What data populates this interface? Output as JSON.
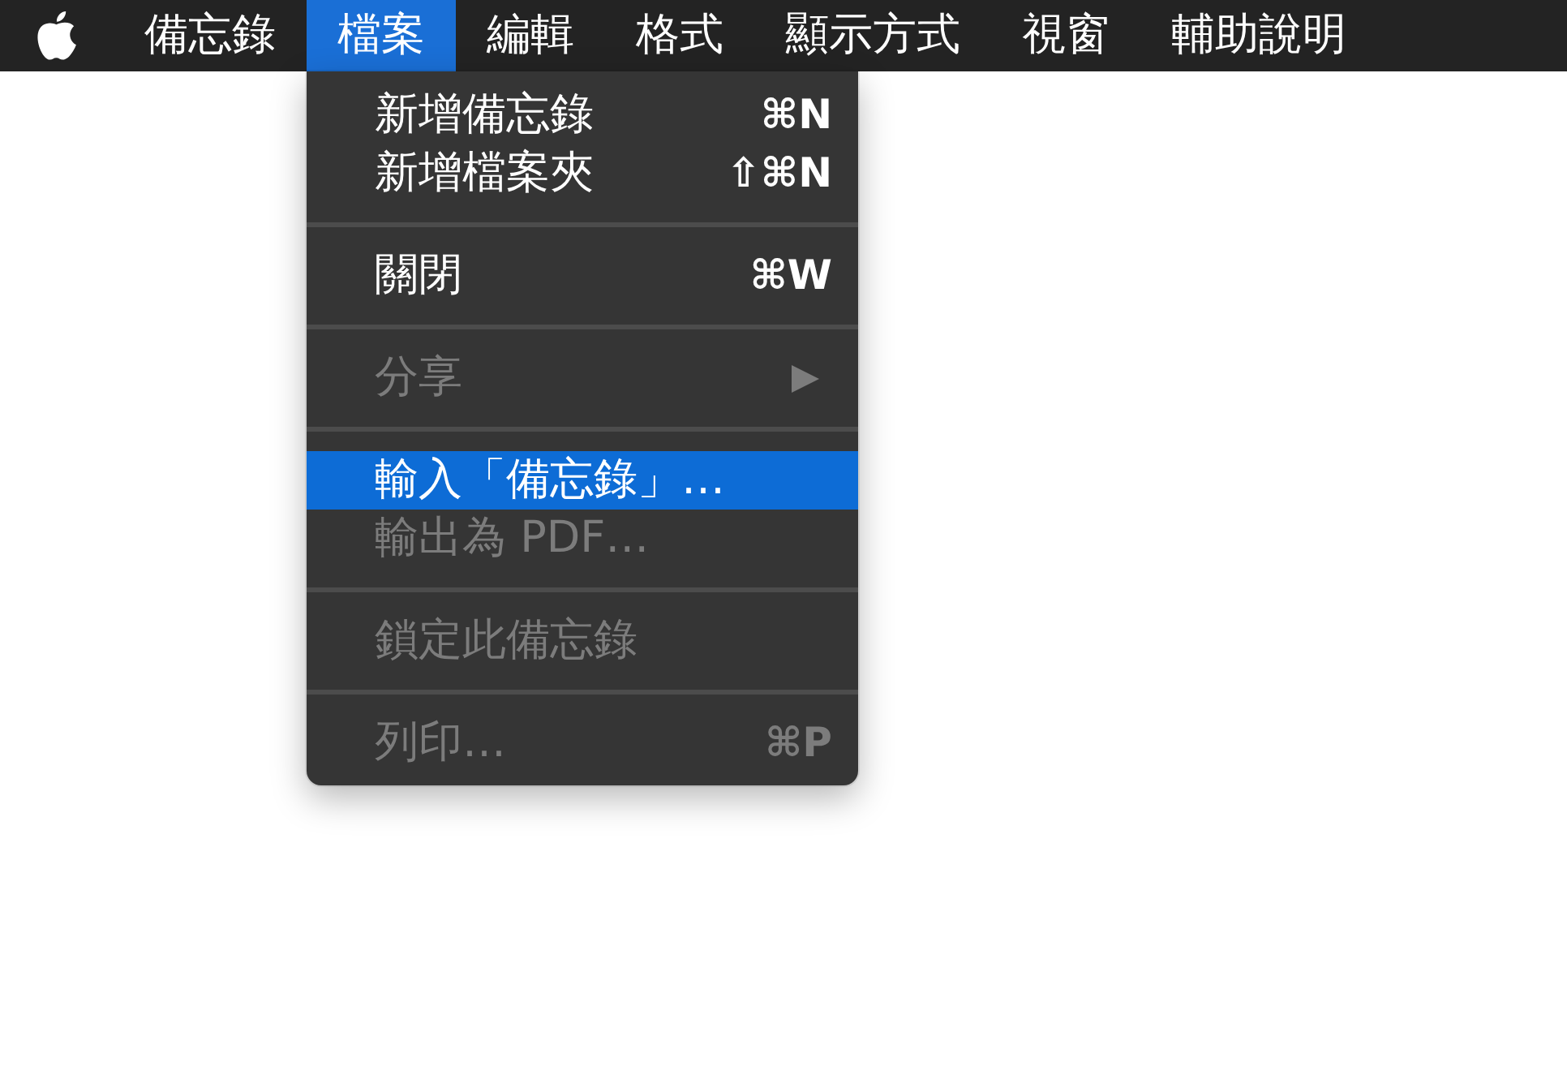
{
  "menu_bar": {
    "items": [
      {
        "label": "備忘錄",
        "selected": false
      },
      {
        "label": "檔案",
        "selected": true
      },
      {
        "label": "編輯",
        "selected": false
      },
      {
        "label": "格式",
        "selected": false
      },
      {
        "label": "顯示方式",
        "selected": false
      },
      {
        "label": "視窗",
        "selected": false
      },
      {
        "label": "輔助說明",
        "selected": false
      }
    ]
  },
  "file_menu": {
    "groups": [
      {
        "items": [
          {
            "kind": "command",
            "label": "新增備忘錄",
            "shortcut": "⌘N",
            "disabled": false,
            "selected": false
          },
          {
            "kind": "command",
            "label": "新增檔案夾",
            "shortcut": "⇧⌘N",
            "disabled": false,
            "selected": false
          }
        ]
      },
      {
        "items": [
          {
            "kind": "command",
            "label": "關閉",
            "shortcut": "⌘W",
            "disabled": false,
            "selected": false
          }
        ]
      },
      {
        "items": [
          {
            "kind": "submenu",
            "label": "分享",
            "disabled": true,
            "selected": false
          }
        ]
      },
      {
        "items": [
          {
            "kind": "command",
            "label": "輸入「備忘錄」…",
            "disabled": false,
            "selected": true
          },
          {
            "kind": "command",
            "label": "輸出為 PDF…",
            "disabled": true,
            "selected": false
          }
        ]
      },
      {
        "items": [
          {
            "kind": "command",
            "label": "鎖定此備忘錄",
            "disabled": true,
            "selected": false
          }
        ]
      },
      {
        "items": [
          {
            "kind": "command",
            "label": "列印…",
            "shortcut": "⌘P",
            "disabled": true,
            "selected": false
          }
        ]
      }
    ]
  }
}
